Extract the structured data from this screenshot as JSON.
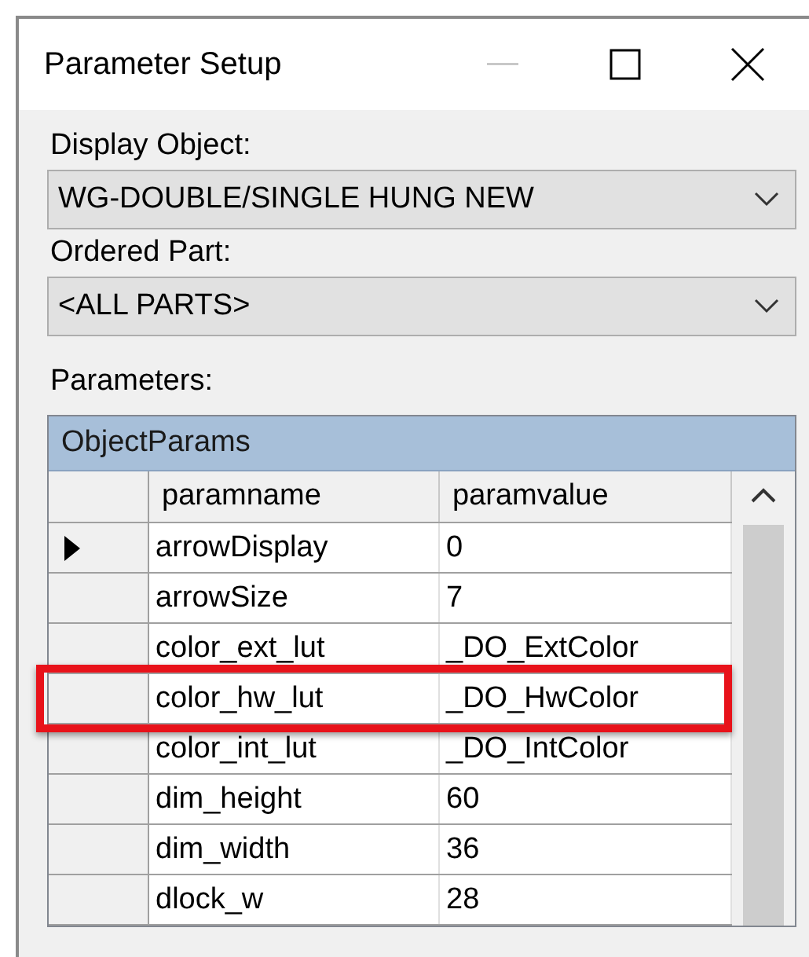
{
  "window": {
    "title": "Parameter Setup",
    "minimize_disabled": true
  },
  "display_object": {
    "label": "Display Object:",
    "value": "WG-DOUBLE/SINGLE HUNG NEW"
  },
  "ordered_part": {
    "label": "Ordered Part:",
    "value": "<ALL PARTS>"
  },
  "parameters": {
    "label": "Parameters:",
    "caption": "ObjectParams",
    "columns": [
      "paramname",
      "paramvalue"
    ],
    "rows": [
      {
        "paramname": "arrowDisplay",
        "paramvalue": "0",
        "current": true,
        "highlighted": false
      },
      {
        "paramname": "arrowSize",
        "paramvalue": "7",
        "current": false,
        "highlighted": false
      },
      {
        "paramname": "color_ext_lut",
        "paramvalue": "_DO_ExtColor",
        "current": false,
        "highlighted": false
      },
      {
        "paramname": "color_hw_lut",
        "paramvalue": "_DO_HwColor",
        "current": false,
        "highlighted": true
      },
      {
        "paramname": "color_int_lut",
        "paramvalue": "_DO_IntColor",
        "current": false,
        "highlighted": false
      },
      {
        "paramname": "dim_height",
        "paramvalue": "60",
        "current": false,
        "highlighted": false
      },
      {
        "paramname": "dim_width",
        "paramvalue": "36",
        "current": false,
        "highlighted": false
      },
      {
        "paramname": "dlock_w",
        "paramvalue": "28",
        "current": false,
        "highlighted": false
      }
    ]
  }
}
